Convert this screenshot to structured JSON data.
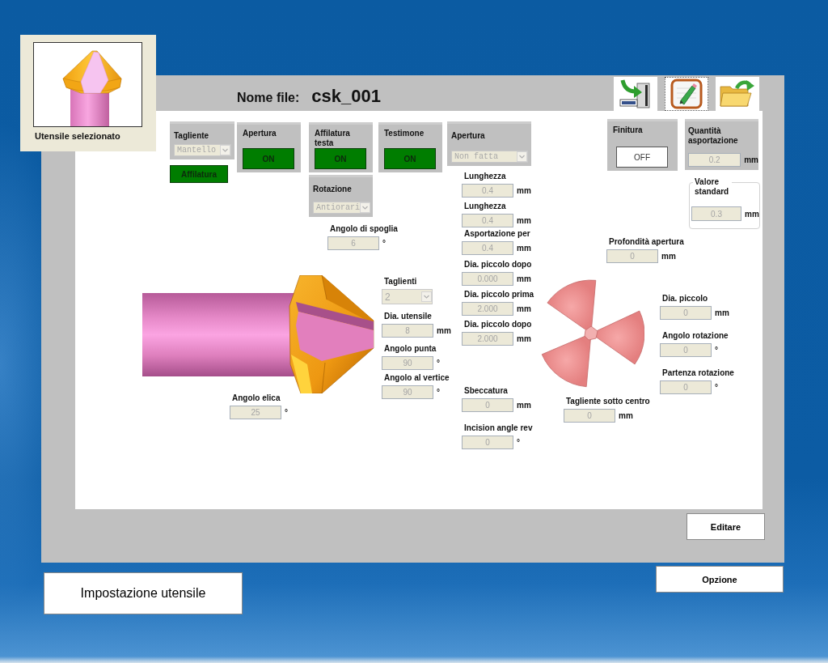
{
  "thumbnail": {
    "caption": "Utensile selezionato"
  },
  "header": {
    "label": "Nome file:",
    "file_name": "csk_001"
  },
  "toolbar": [
    {
      "kind": "save",
      "selected": false
    },
    {
      "kind": "edit",
      "selected": true
    },
    {
      "kind": "open",
      "selected": false
    }
  ],
  "controls": [
    {
      "kind": "select",
      "label": "Tagliente",
      "value": "Mantello",
      "disabled": true
    },
    {
      "kind": "toggle",
      "label": "Apertura",
      "state": "ON",
      "on": true
    },
    {
      "kind": "toggle",
      "label": "Affilatura testa",
      "state": "ON",
      "on": true
    },
    {
      "kind": "toggle",
      "label": "Testimone",
      "state": "ON",
      "on": true
    },
    {
      "kind": "select",
      "label": "Apertura",
      "value": "Non fatta",
      "disabled": true
    },
    {
      "kind": "toggle",
      "label": "Finitura",
      "state": "OFF",
      "on": false
    },
    {
      "kind": "boxfield",
      "label": "Quantità asportazione",
      "value": "0.2",
      "unit": "mm",
      "disabled": true
    },
    {
      "kind": "button",
      "label": "Affilatura",
      "on": true
    },
    {
      "kind": "select",
      "label": "Rotazione",
      "value": "Antiorari",
      "disabled": true
    },
    {
      "kind": "field",
      "label": "Lunghezza",
      "value": "0.4",
      "unit": "mm",
      "disabled": true
    },
    {
      "kind": "fieldset",
      "label": "Valore standard",
      "value": "0.3",
      "unit": "mm",
      "disabled": true
    },
    {
      "kind": "field",
      "label": "Lunghezza",
      "value": "0.4",
      "unit": "mm",
      "disabled": true
    },
    {
      "kind": "field",
      "label": "Angolo di spoglia",
      "value": "6",
      "unit": "°",
      "disabled": true
    },
    {
      "kind": "field",
      "label": "Asportazione per",
      "value": "0.4",
      "unit": "mm",
      "disabled": true
    },
    {
      "kind": "field",
      "label": "Profondità apertura",
      "value": "0",
      "unit": "mm",
      "disabled": true
    },
    {
      "kind": "field",
      "label": "Dia. piccolo dopo",
      "value": "0.000",
      "unit": "mm",
      "disabled": true
    },
    {
      "kind": "dropdown",
      "label": "Taglienti",
      "value": "2",
      "disabled": true
    },
    {
      "kind": "field",
      "label": "Dia. piccolo prima",
      "value": "2.000",
      "unit": "mm",
      "disabled": true
    },
    {
      "kind": "field",
      "label": "Dia. piccolo",
      "value": "0",
      "unit": "mm",
      "disabled": true
    },
    {
      "kind": "field",
      "label": "Dia. utensile",
      "value": "8",
      "unit": "mm",
      "disabled": true
    },
    {
      "kind": "field",
      "label": "Dia. piccolo dopo",
      "value": "2.000",
      "unit": "mm",
      "disabled": true
    },
    {
      "kind": "field",
      "label": "Angolo rotazione",
      "value": "0",
      "unit": "°",
      "disabled": true
    },
    {
      "kind": "field",
      "label": "Angolo punta",
      "value": "90",
      "unit": "°",
      "disabled": true
    },
    {
      "kind": "field",
      "label": "Partenza rotazione",
      "value": "0",
      "unit": "°",
      "disabled": true
    },
    {
      "kind": "field",
      "label": "Angolo al vertice",
      "value": "90",
      "unit": "°",
      "disabled": true
    },
    {
      "kind": "field",
      "label": "Sbeccatura",
      "value": "0",
      "unit": "mm",
      "disabled": true
    },
    {
      "kind": "field",
      "label": "Angolo elica",
      "value": "25",
      "unit": "°",
      "disabled": true
    },
    {
      "kind": "field",
      "label": "Tagliente sotto centro",
      "value": "0",
      "unit": "mm",
      "disabled": true
    },
    {
      "kind": "field",
      "label": "Incision angle rev",
      "value": "0",
      "unit": "°",
      "disabled": true
    }
  ],
  "buttons": [
    {
      "label": "Editare"
    },
    {
      "label": "Opzione"
    },
    {
      "label": "Impostazione utensile"
    }
  ]
}
